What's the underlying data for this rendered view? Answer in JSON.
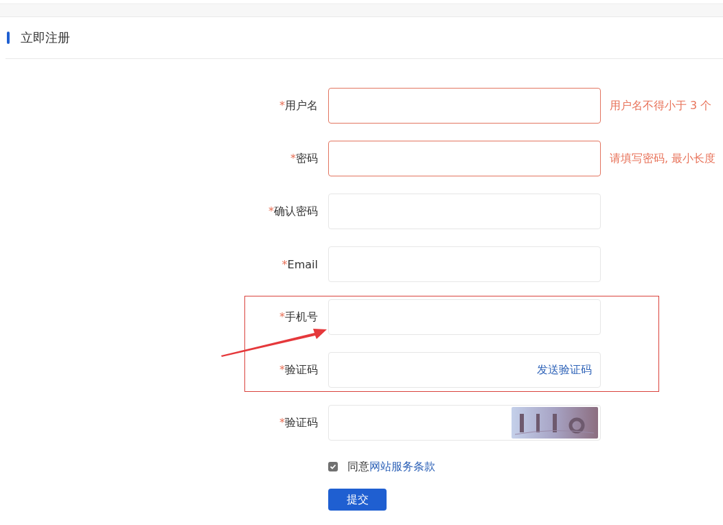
{
  "header": {
    "title": "立即注册"
  },
  "fields": [
    {
      "kind": "text",
      "mark": "*",
      "label": "用户名",
      "error": true,
      "message": "用户名不得小于 3 个"
    },
    {
      "kind": "text",
      "mark": "*",
      "label": "密码",
      "error": true,
      "message": "请填写密码, 最小长度"
    },
    {
      "kind": "text",
      "mark": "*",
      "label": "确认密码",
      "error": false
    },
    {
      "kind": "text",
      "mark": "*",
      "label": "Email",
      "error": false
    },
    {
      "kind": "text",
      "mark": "*",
      "label": "手机号",
      "error": false
    },
    {
      "kind": "sms",
      "mark": "*",
      "label": "验证码",
      "error": false,
      "action": "发送验证码"
    },
    {
      "kind": "captcha",
      "mark": "*",
      "label": "验证码",
      "error": false
    }
  ],
  "agreement": {
    "checked": true,
    "text": "同意",
    "link": "网站服务条款"
  },
  "submit": "提交"
}
